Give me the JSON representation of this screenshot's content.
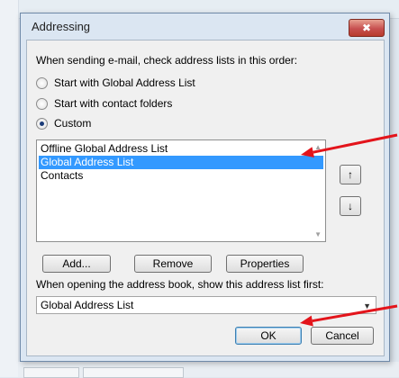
{
  "dialog": {
    "title": "Addressing",
    "close_glyph": "✖",
    "prompt": "When sending e-mail, check address lists in this order:",
    "options": [
      {
        "label": "Start with Global Address List",
        "checked": false
      },
      {
        "label": "Start with contact folders",
        "checked": false
      },
      {
        "label": "Custom",
        "checked": true
      }
    ],
    "address_lists": [
      {
        "label": "Offline Global Address List",
        "selected": false
      },
      {
        "label": "Global Address List",
        "selected": true
      },
      {
        "label": "Contacts",
        "selected": false
      }
    ],
    "move_up_glyph": "↑",
    "move_down_glyph": "↓",
    "buttons": {
      "add": "Add...",
      "remove": "Remove",
      "properties": "Properties"
    },
    "open_prompt": "When opening the address book, show this address list first:",
    "open_value": "Global Address List",
    "ok": "OK",
    "cancel": "Cancel"
  },
  "annotations": {
    "arrow_color": "#e3141b"
  }
}
